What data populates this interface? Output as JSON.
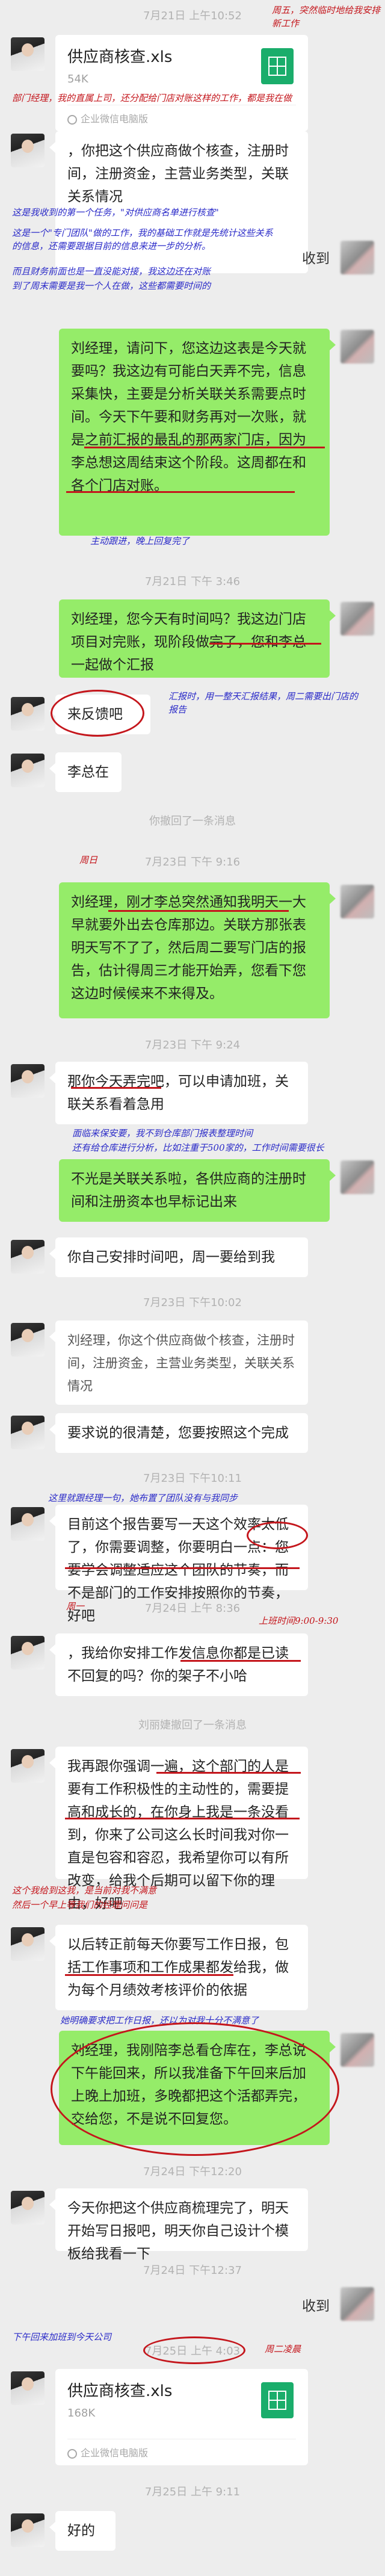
{
  "messages": {
    "ts1": "7月21日 上午10:52",
    "file1_name": "供应商核查.xls",
    "file1_size": "54K",
    "file_source": "企业微信电脑版",
    "msg1": "，你把这个供应商做个核查，注册时间，注册资金，主营业务类型，关联关系情况",
    "received1": "收到",
    "msg2": "刘经理，请问下，您这边这表是今天就要吗？我这边有可能白天弄不完，信息采集快，主要是分析关联关系需要点时间。今天下午要和财务再对一次账，就是之前汇报的最乱的那两家门店，因为李总想这周结束这个阶段。这周都在和各个门店对账。",
    "ts2": "7月21日 下午 3:46",
    "msg3": "刘经理，您今天有时间吗？我这边门店项目对完账，现阶段做完了，您和李总一起做个汇报",
    "msg4": "来反馈吧",
    "msg5": "李总在",
    "recall1": "你撤回了一条消息",
    "ts3": "7月23日 下午 9:16",
    "msg6": "刘经理，刚才李总突然通知我明天一大早就要外出去仓库那边。关联方那张表明天写不了了，然后周二要写门店的报告，估计得周三才能开始弄，您看下您这边时候候来不来得及。",
    "ts4": "7月23日 下午 9:24",
    "msg7": "那你今天弄完吧，可以申请加班，关联关系看着急用",
    "msg8": "不光是关联关系啦，各供应商的注册时间和注册资本也早标记出来",
    "msg9": "你自己安排时间吧，周一要给到我",
    "ts5": "7月23日 下午10:02",
    "msg10": "刘经理，你这个供应商做个核查，注册时间，注册资金，主营业务类型，关联关系情况",
    "msg11": "要求说的很清楚，您要按照这个完成",
    "ts6": "7月23日 下午10:11",
    "msg12": "目前这个报告要写一天这个效率太低了，你需要调整，你要明白一点：您要学会调整适应这个团队的节奏，而不是部门的工作安排按照你的节奏，好吧",
    "ts7": "7月24日 上午 8:36",
    "msg13": "，我给你安排工作发信息你都是已读不回复的吗？你的架子不小哈",
    "recall2": "刘丽婕撤回了一条消息",
    "msg14": "我再跟你强调一遍，这个部门的人是要有工作积极性的主动性的，需要提高和成长的，在你身上我是一条没看到，你来了公司这么长时间我对你一直是包容和容忍，我希望你可以有所改变，给我个后期可以留下你的理由，好吧",
    "msg15": "以后转正前每天你要写工作日报，包括工作事项和工作成果都发给我，做为每个月绩效考核评价的依据",
    "msg16": "刘经理，我刚陪李总看仓库在，李总说下午能回来，所以我准备下午回来后加上晚上加班，多晚都把这个活都弄完，交给您，不是说不回复您。",
    "ts8": "7月24日 下午12:20",
    "msg17": "今天你把这个供应商梳理完了，明天开始写日报吧，明天你自己设计个模板给我看一下",
    "ts9": "7月24日 下午12:37",
    "received2": "收到",
    "ts10": "7月25日 上午 4:03",
    "file2_name": "供应商核查.xls",
    "file2_size": "168K",
    "ts11": "7月25日 上午 9:11",
    "msg18": "好的"
  },
  "annotations": {
    "a1": "周五，突然临时地给我安排新工作",
    "a2": "部门经理，我的直属上司，还分配给门店对账这样的工作，都是我在做",
    "a3": "这是我收到的第一个任务，\"对供应商名单进行核查\"",
    "a4": "这是一个\"专门团队\"做的工作，我的基础工作就是先统计这些关系的信息，还需要跟据目前的信息来进一步的分析。",
    "a5": "而且财务前面也是一直没能对接，我这边还在对账",
    "a6": "到了周末需要是我一个人在做，这些都需要时间的",
    "a7": "主动跟进，晚上回复完了",
    "a8": "汇报时，用一整天汇报结果，周二需要出门店的报告",
    "a9": "周日",
    "a10": "面临来保安要，我不到仓库部门报表整理时间",
    "a11": "还有给仓库进行分析，比如注重于500家的，工作时间需要很长",
    "a12": "周日",
    "a13": "这里就跟经理一句，她布置了团队没有与我同步",
    "a14": "上班时间9:00-9:30",
    "a15": "周一",
    "a16": "这个我给到这我，是当前对我不满意",
    "a17": "然后一个早上等我们的经理问问是",
    "a18": "她明确要求把工作日报，还以为对我十分不满意了",
    "a19": "下午回来加班到今天公司",
    "a20": "周二凌晨"
  }
}
